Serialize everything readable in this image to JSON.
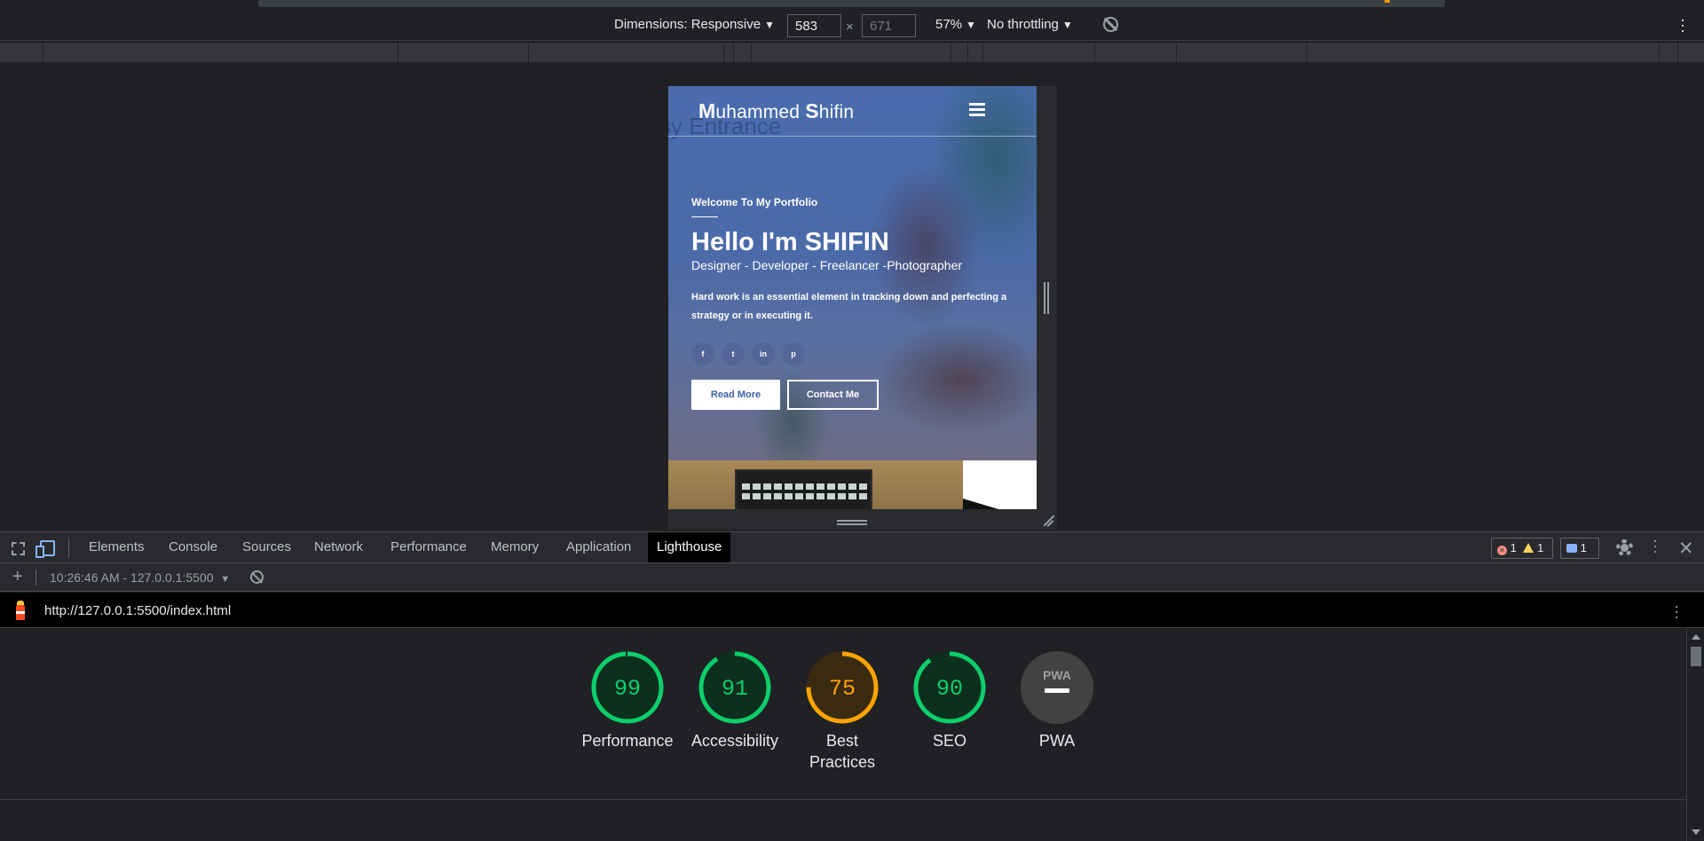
{
  "device_toolbar": {
    "dimensions_label": "Dimensions: Responsive",
    "width_value": "583",
    "height_placeholder": "671",
    "times_sign": "×",
    "zoom": "57%",
    "throttling": "No throttling"
  },
  "site": {
    "brand_first_initial": "M",
    "brand_first_rest": "uhammed ",
    "brand_last_initial": "S",
    "brand_last_rest": "hifin",
    "background_sign": "sy Entrance",
    "welcome": "Welcome To My Portfolio",
    "heading": "Hello I'm SHIFIN",
    "roles": "Designer - Developer - Freelancer -Photographer",
    "description": "Hard work is an essential element in tracking down and perfecting a strategy or in executing it.",
    "socials": [
      {
        "icon": "facebook-icon",
        "glyph": "f"
      },
      {
        "icon": "twitter-icon",
        "glyph": "t"
      },
      {
        "icon": "linkedin-icon",
        "glyph": "in"
      },
      {
        "icon": "pinterest-icon",
        "glyph": "p"
      }
    ],
    "read_more": "Read More",
    "contact_me": "Contact Me"
  },
  "devtools": {
    "tabs": [
      {
        "label": "Elements",
        "active": false
      },
      {
        "label": "Console",
        "active": false
      },
      {
        "label": "Sources",
        "active": false
      },
      {
        "label": "Network",
        "active": false
      },
      {
        "label": "Performance",
        "active": false
      },
      {
        "label": "Memory",
        "active": false
      },
      {
        "label": "Application",
        "active": false
      },
      {
        "label": "Lighthouse",
        "active": true
      }
    ],
    "errors": "1",
    "warnings": "1",
    "messages": "1"
  },
  "lighthouse": {
    "report_label": "10:26:46 AM - 127.0.0.1:5500",
    "url": "http://127.0.0.1:5500/index.html",
    "scores": [
      {
        "label": "Performance",
        "score": "99",
        "value": 99,
        "color": "#0cce6b",
        "track": "#0d2f1d"
      },
      {
        "label": "Accessibility",
        "score": "91",
        "value": 91,
        "color": "#0cce6b",
        "track": "#0d2f1d"
      },
      {
        "label": "Best Practices",
        "score": "75",
        "value": 75,
        "color": "#ffa400",
        "track": "#3a2a10"
      },
      {
        "label": "SEO",
        "score": "90",
        "value": 90,
        "color": "#0cce6b",
        "track": "#0d2f1d"
      },
      {
        "label": "PWA",
        "badge": "PWA"
      }
    ]
  },
  "colors": {
    "accent_blue": "#8ab4f8",
    "pass_green": "#0cce6b",
    "average_orange": "#ffa400"
  }
}
